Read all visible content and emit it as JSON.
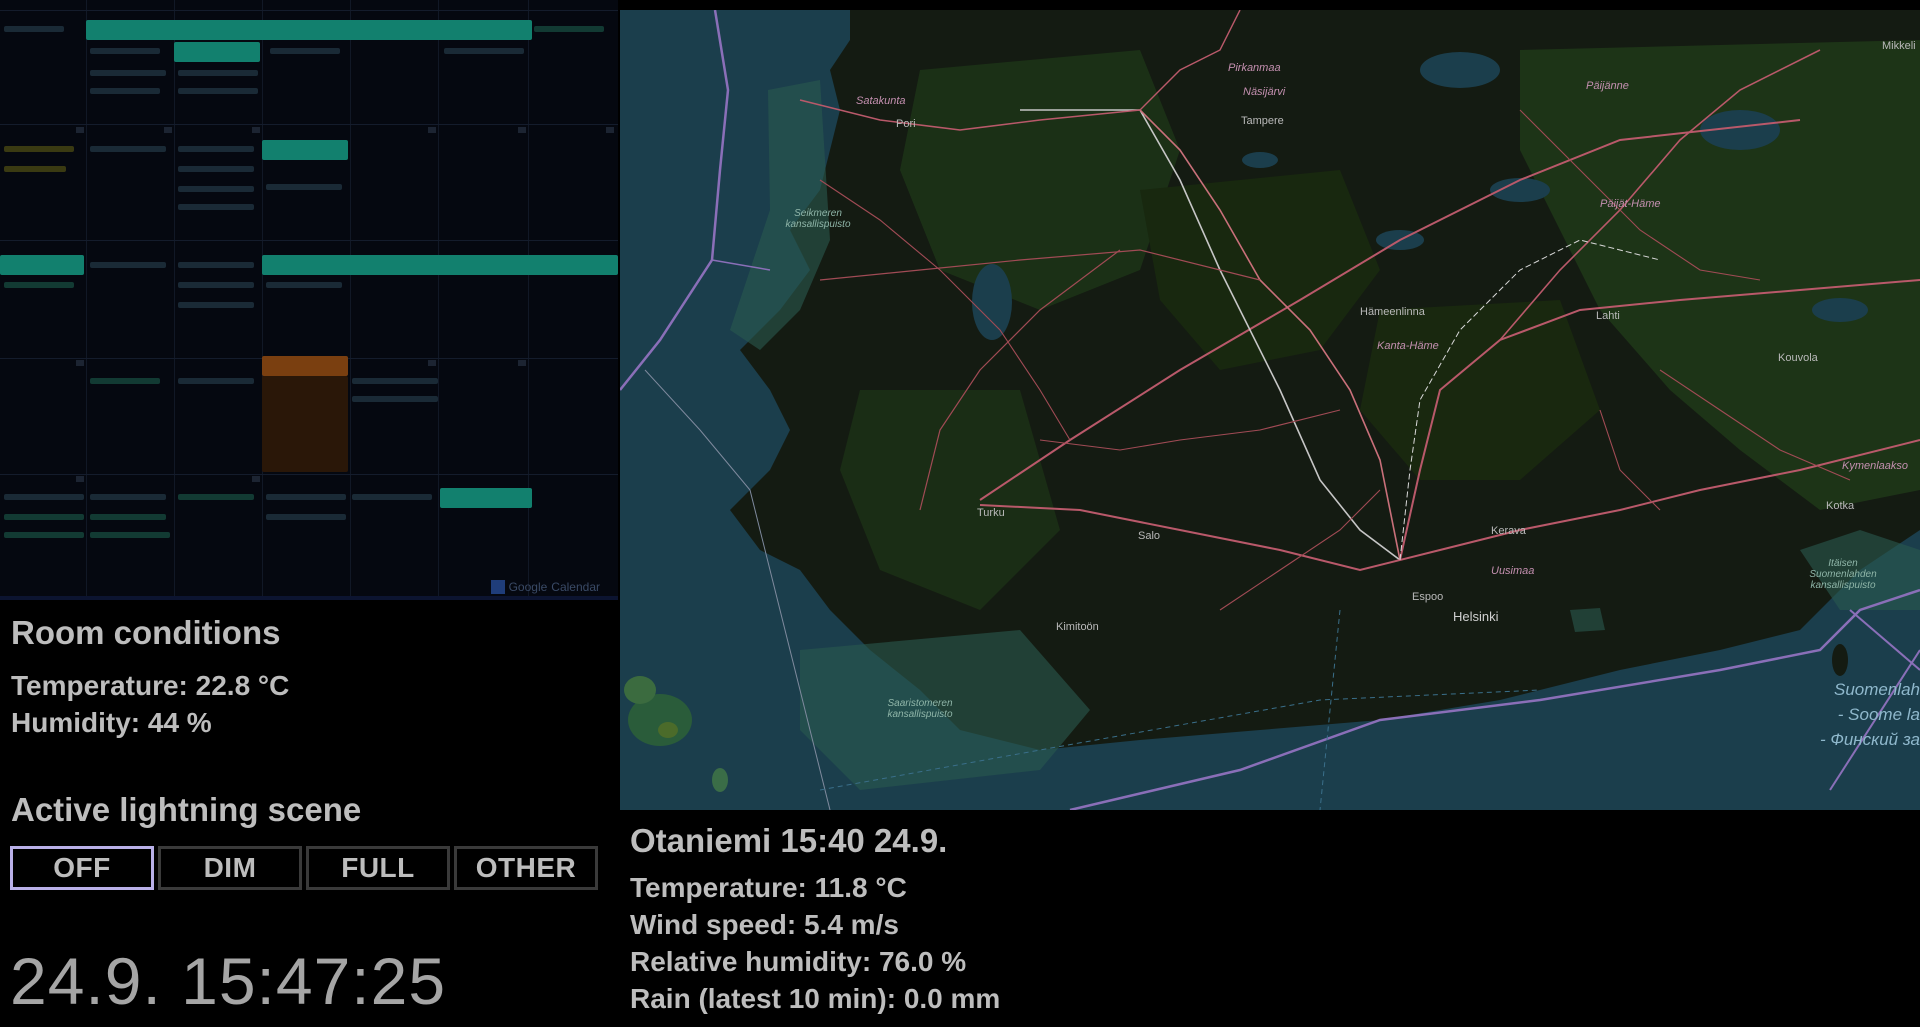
{
  "calendar": {
    "footer_brand_google": "Google",
    "footer_brand_calendar": "Calendar"
  },
  "room": {
    "title": "Room conditions",
    "temperature": "Temperature: 22.8 °C",
    "humidity": "Humidity: 44 %"
  },
  "lighting": {
    "title": "Active lightning scene",
    "buttons": [
      "OFF",
      "DIM",
      "FULL",
      "OTHER"
    ],
    "active": "OFF",
    "active_border_color": "#b9b0e8"
  },
  "clock": "24.9. 15:47:25",
  "map": {
    "places": {
      "satakunta": "Satakunta",
      "pori": "Pori",
      "pirkanmaa": "Pirkanmaa",
      "nasijarvi": "Näsijärvi",
      "tampere": "Tampere",
      "paijanne": "Päijänne",
      "mikkeli": "Mikkeli",
      "paijat_hame": "Päijät-Häme",
      "seikmeren": "Seikmeren kansallispuisto",
      "hameenlinna": "Hämeenlinna",
      "kanta_hame": "Kanta-Häme",
      "lahti": "Lahti",
      "kouvola": "Kouvola",
      "kymenlaakso": "Kymenlaakso",
      "turku": "Turku",
      "salo": "Salo",
      "kerava": "Kerava",
      "kotka": "Kotka",
      "uusimaa": "Uusimaa",
      "espoo": "Espoo",
      "helsinki": "Helsinki",
      "kimitoon": "Kimitoön",
      "itainen": "Itäisen Suomenlahden kansallispuisto",
      "saaristomeren": "Saaristomeren kansallispuisto",
      "sea1": "Suomenlah",
      "sea2": "- Soome la",
      "sea3": "- Финский за"
    }
  },
  "weather": {
    "title": "Otaniemi 15:40 24.9.",
    "temperature": "Temperature: 11.8 °C",
    "wind": "Wind speed: 5.4 m/s",
    "humidity": "Relative humidity: 76.0 %",
    "rain": "Rain (latest 10 min): 0.0 mm"
  }
}
